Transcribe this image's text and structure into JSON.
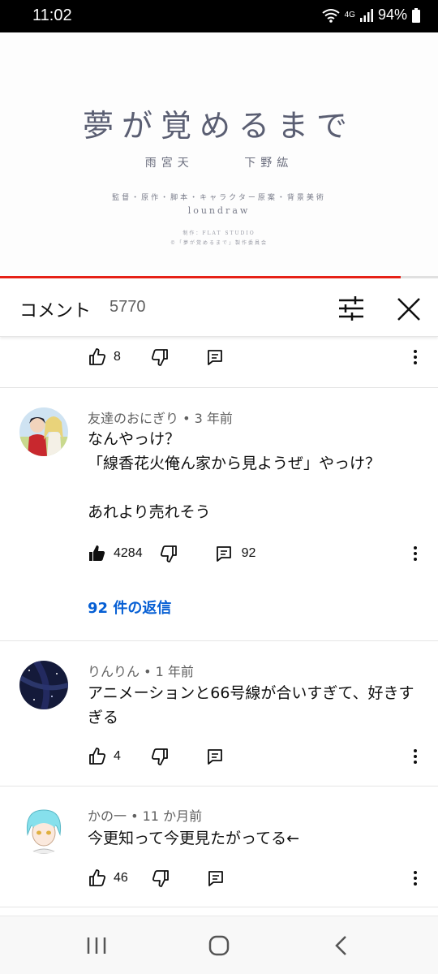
{
  "status_bar": {
    "time": "11:02",
    "network": "4G",
    "battery": "94%"
  },
  "video": {
    "title": "夢が覚めるまで",
    "cast": [
      "雨宮天",
      "下野紘"
    ],
    "credit": "監督・原作・脚本・キャラクター原案・背景美術",
    "director": "loundraw",
    "small_line1": "制作：FLAT STUDIO",
    "small_line2": "©「夢が覚めるまで」製作委員会",
    "progress": 0.915,
    "accent_color": "#e62117"
  },
  "comments_header": {
    "title": "コメント",
    "count": "5770"
  },
  "comments": [
    {
      "actions": {
        "likes": "8",
        "replies": ""
      }
    },
    {
      "author": "友達のおにぎり",
      "time": "3 年前",
      "text": "なんやっけ？\n「線香花火俺ん家から見ようぜ」やっけ？\n\nあれより売れそう",
      "actions": {
        "likes": "4284",
        "replies": "92"
      },
      "replies_link": "92 件の返信"
    },
    {
      "author": "りんりん",
      "time": "1 年前",
      "text": "アニメーションと66号線が合いすぎて、好きすぎる",
      "actions": {
        "likes": "4",
        "replies": ""
      }
    },
    {
      "author": "かの一",
      "time": "11 か月前",
      "text": "今更知って今更見たがってる←",
      "actions": {
        "likes": "46",
        "replies": ""
      }
    }
  ],
  "icons": {
    "like": "thumb-up-icon",
    "dislike": "thumb-down-icon",
    "reply": "comment-icon",
    "more": "more-vert-icon",
    "filter": "tune-icon",
    "close": "close-icon"
  },
  "link_color": "#065fd4"
}
